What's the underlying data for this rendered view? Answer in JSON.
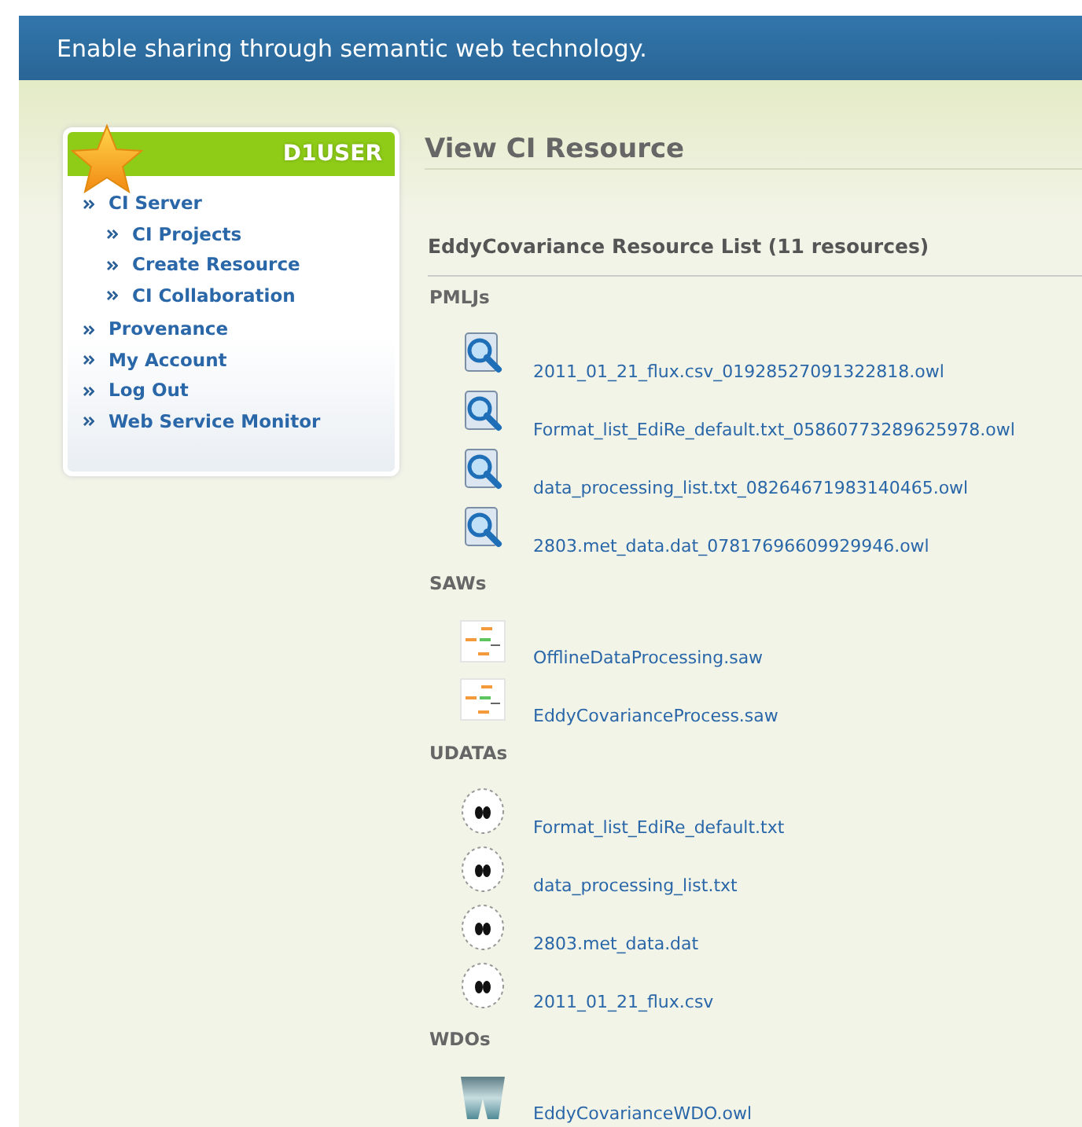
{
  "banner": {
    "tagline": "Enable sharing through semantic web technology."
  },
  "sidebar": {
    "user": "D1USER",
    "items": [
      {
        "label": "CI Server",
        "children": [
          {
            "label": "CI Projects"
          },
          {
            "label": "Create Resource"
          },
          {
            "label": "CI Collaboration"
          }
        ]
      },
      {
        "label": "Provenance"
      },
      {
        "label": "My Account"
      },
      {
        "label": "Log Out"
      },
      {
        "label": "Web Service Monitor"
      }
    ]
  },
  "page_title": "View CI Resource",
  "list_title": "EddyCovariance Resource List (11 resources)",
  "sections": [
    {
      "label": "PMLJs",
      "kind": "pml",
      "items": [
        "2011_01_21_flux.csv_01928527091322818.owl",
        "Format_list_EdiRe_default.txt_05860773289625978.owl",
        "data_processing_list.txt_08264671983140465.owl",
        "2803.met_data.dat_07817696609929946.owl"
      ]
    },
    {
      "label": "SAWs",
      "kind": "saw",
      "items": [
        "OfflineDataProcessing.saw",
        "EddyCovarianceProcess.saw"
      ]
    },
    {
      "label": "UDATAs",
      "kind": "udata",
      "items": [
        "Format_list_EdiRe_default.txt",
        "data_processing_list.txt",
        "2803.met_data.dat",
        "2011_01_21_flux.csv"
      ]
    },
    {
      "label": "WDOs",
      "kind": "wdo",
      "items": [
        "EddyCovarianceWDO.owl"
      ]
    }
  ]
}
